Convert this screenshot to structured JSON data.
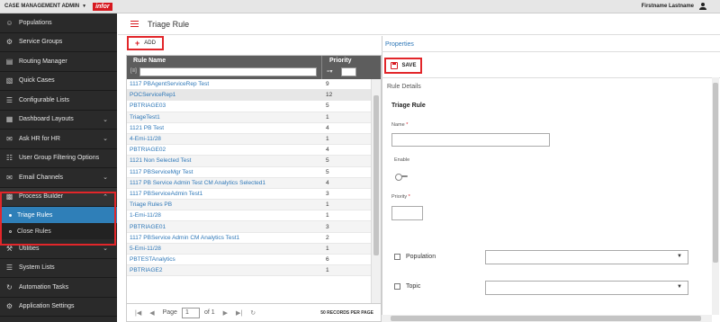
{
  "topbar": {
    "app_name": "CASE MANAGEMENT ADMIN",
    "logo": "infor",
    "user_name": "Firstname Lastname"
  },
  "sidebar": {
    "items": [
      {
        "label": "Populations",
        "icon": "people-icon"
      },
      {
        "label": "Service Groups",
        "icon": "settings-icon"
      },
      {
        "label": "Routing Manager",
        "icon": "routing-icon"
      },
      {
        "label": "Quick Cases",
        "icon": "document-icon"
      },
      {
        "label": "Configurable Lists",
        "icon": "list-icon"
      },
      {
        "label": "Dashboard Layouts",
        "icon": "dashboard-icon"
      },
      {
        "label": "Ask HR for HR",
        "icon": "chat-icon"
      },
      {
        "label": "User Group Filtering Options",
        "icon": "filter-icon"
      },
      {
        "label": "Email Channels",
        "icon": "email-icon"
      },
      {
        "label": "Process Builder",
        "icon": "process-icon"
      }
    ],
    "sub_items": [
      {
        "label": "Triage Rules"
      },
      {
        "label": "Close Rules"
      }
    ],
    "items_after": [
      {
        "label": "Utilities",
        "icon": "tools-icon"
      },
      {
        "label": "System Lists",
        "icon": "list-icon"
      },
      {
        "label": "Automation Tasks",
        "icon": "automation-icon"
      },
      {
        "label": "Application Settings",
        "icon": "gear-icon"
      }
    ]
  },
  "header": {
    "title": "Triage Rule"
  },
  "toolbar": {
    "add_label": "ADD",
    "save_label": "SAVE"
  },
  "grid": {
    "columns": [
      "Rule Name",
      "Priority"
    ],
    "rows": [
      {
        "name": "1117 PBAgentServiceRep Test",
        "priority": "9"
      },
      {
        "name": "POCServiceRep1",
        "priority": "12"
      },
      {
        "name": "PBTRIAGE03",
        "priority": "5"
      },
      {
        "name": "TriageTest1",
        "priority": "1"
      },
      {
        "name": "1121 PB Test",
        "priority": "4"
      },
      {
        "name": "4-Emi-11/28",
        "priority": "1"
      },
      {
        "name": "PBTRIAGE02",
        "priority": "4"
      },
      {
        "name": "1121 Non Selected Test",
        "priority": "5"
      },
      {
        "name": "1117 PBServiceMgr Test",
        "priority": "5"
      },
      {
        "name": "1117 PB Service Admin Test CM Analytics Selected1",
        "priority": "4"
      },
      {
        "name": "1117 PBServiceAdmin Test1",
        "priority": "3"
      },
      {
        "name": "Triage Rules PB",
        "priority": "1"
      },
      {
        "name": "1-Emi-11/28",
        "priority": "1"
      },
      {
        "name": "PBTRIAGE01",
        "priority": "3"
      },
      {
        "name": "1117 PBService Admin CM Analytics Test1",
        "priority": "2"
      },
      {
        "name": "5-Emi-11/28",
        "priority": "1"
      },
      {
        "name": "PBTESTAnalytics",
        "priority": "6"
      },
      {
        "name": "PBTRIAGE2",
        "priority": "1"
      }
    ]
  },
  "pager": {
    "page_label": "Page",
    "page_value": "1",
    "of_label": "of 1",
    "per_page": "50 RECORDS PER PAGE"
  },
  "panel": {
    "properties_link": "Properties",
    "rule_details": "Rule Details",
    "section_title": "Triage Rule",
    "name_label": "Name",
    "enable_label": "Enable",
    "priority_label": "Priority",
    "population_label": "Population",
    "topic_label": "Topic"
  },
  "colors": {
    "accent": "#d71920",
    "sidebar_bg": "#2a2a2a",
    "active_blue": "#2f7fb8",
    "link_blue": "#2f78b8",
    "highlight": "#e2262a"
  }
}
